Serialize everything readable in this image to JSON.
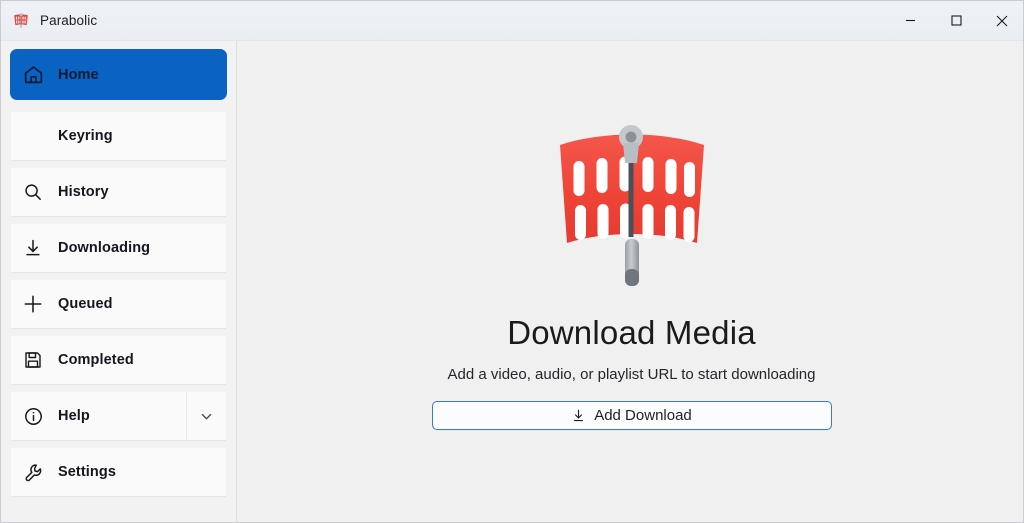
{
  "window": {
    "title": "Parabolic",
    "app_icon": "parabolic-logo-icon",
    "controls": {
      "minimize": "minimize-icon",
      "maximize": "maximize-icon",
      "close": "close-icon"
    }
  },
  "colors": {
    "accent": "#0a62c2",
    "brand_red": "#f04438",
    "titlebar_bg": "#eef1f6",
    "sidebar_bg": "#f2f2f2",
    "main_bg": "#f0f0f0",
    "button_border": "#3a7cbe"
  },
  "sidebar": {
    "items": [
      {
        "label": "Home",
        "icon": "home-icon",
        "selected": true,
        "expandable": false
      },
      {
        "label": "Keyring",
        "icon": "none",
        "selected": false,
        "expandable": false
      },
      {
        "label": "History",
        "icon": "search-icon",
        "selected": false,
        "expandable": false
      },
      {
        "label": "Downloading",
        "icon": "download-icon",
        "selected": false,
        "expandable": false
      },
      {
        "label": "Queued",
        "icon": "plus-icon",
        "selected": false,
        "expandable": false
      },
      {
        "label": "Completed",
        "icon": "save-floppy-icon",
        "selected": false,
        "expandable": false
      },
      {
        "label": "Help",
        "icon": "info-circle-icon",
        "selected": false,
        "expandable": true,
        "expand_icon": "chevron-down-icon"
      },
      {
        "label": "Settings",
        "icon": "wrench-icon",
        "selected": false,
        "expandable": false
      }
    ]
  },
  "main": {
    "logo_icon": "parabolic-dish-logo",
    "headline": "Download Media",
    "subtext": "Add a video, audio, or playlist URL to start downloading",
    "add_download": {
      "label": "Add Download",
      "icon": "download-arrow-icon"
    }
  }
}
